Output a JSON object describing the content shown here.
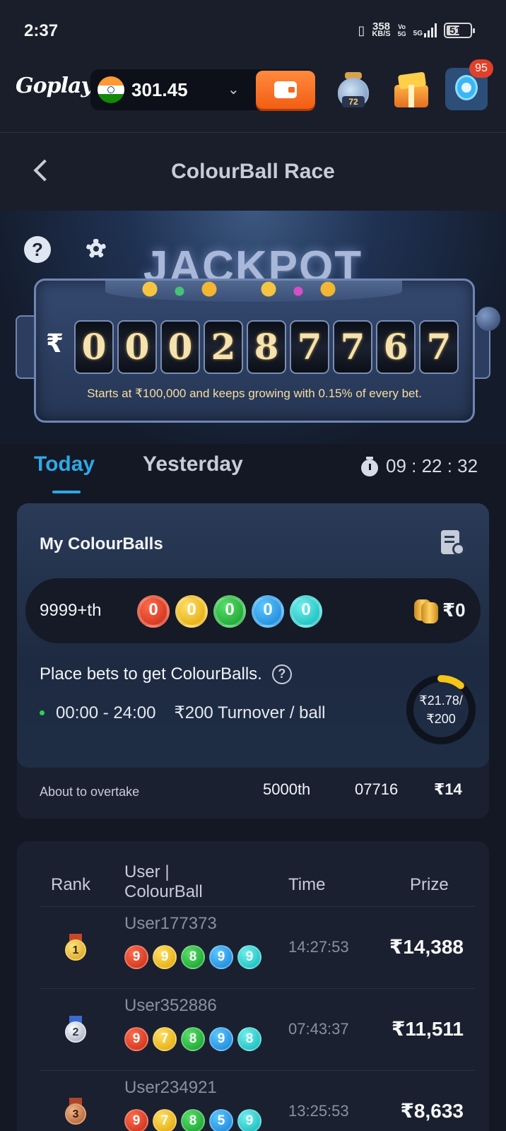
{
  "status_bar": {
    "time": "2:37",
    "net_speed": "358",
    "net_unit": "KB/S",
    "volte_top": "Vo",
    "volte_bottom": "5G",
    "network": "5G",
    "battery": "51"
  },
  "app_header": {
    "logo": "Goplay",
    "balance": "301.45",
    "jar_count": "72",
    "notification_count": "95"
  },
  "page": {
    "title": "ColourBall Race"
  },
  "jackpot": {
    "word": "JACKPOT",
    "currency": "₹",
    "digits": [
      "0",
      "0",
      "0",
      "2",
      "8",
      "7",
      "7",
      "6",
      "7"
    ],
    "note": "Starts at ₹100,000 and keeps growing with 0.15% of every bet."
  },
  "tabs": {
    "today": "Today",
    "yesterday": "Yesterday",
    "active": "Today",
    "countdown": "09 : 22 : 32"
  },
  "my_colourballs": {
    "title": "My ColourBalls",
    "rank": "9999+th",
    "balls": [
      "0",
      "0",
      "0",
      "0",
      "0"
    ],
    "prize": "₹0",
    "place_bets_text": "Place bets to get ColourBalls.",
    "help_icon": "?",
    "schedule": "00:00 - 24:00",
    "turnover_rule": "₹200 Turnover / ball",
    "progress_current": "₹21.78/",
    "progress_target": "₹200",
    "progress_fraction": 0.1089,
    "about_to_overtake_label": "About to overtake",
    "overtake_rank": "5000th",
    "overtake_ball": "07716",
    "overtake_prize": "₹14"
  },
  "leaderboard": {
    "headers": {
      "rank": "Rank",
      "user_line1": "User |",
      "user_line2": "ColourBall",
      "time": "Time",
      "prize": "Prize"
    },
    "rows": [
      {
        "rank": "1",
        "user": "User177373",
        "balls": [
          "9",
          "9",
          "8",
          "9",
          "9"
        ],
        "time": "14:27:53",
        "prize": "₹14,388"
      },
      {
        "rank": "2",
        "user": "User352886",
        "balls": [
          "9",
          "7",
          "8",
          "9",
          "8"
        ],
        "time": "07:43:37",
        "prize": "₹11,511"
      },
      {
        "rank": "3",
        "user": "User234921",
        "balls": [
          "9",
          "7",
          "8",
          "5",
          "9"
        ],
        "time": "13:25:53",
        "prize": "₹8,633"
      }
    ]
  },
  "ball_colors": [
    "#d9351a",
    "#f0b400",
    "#1fb33a",
    "#1f95e8",
    "#17c6c4"
  ],
  "accent_color": "#2fa8e6",
  "wallet_color": "#f26a20",
  "ring_color": "#f5c518"
}
